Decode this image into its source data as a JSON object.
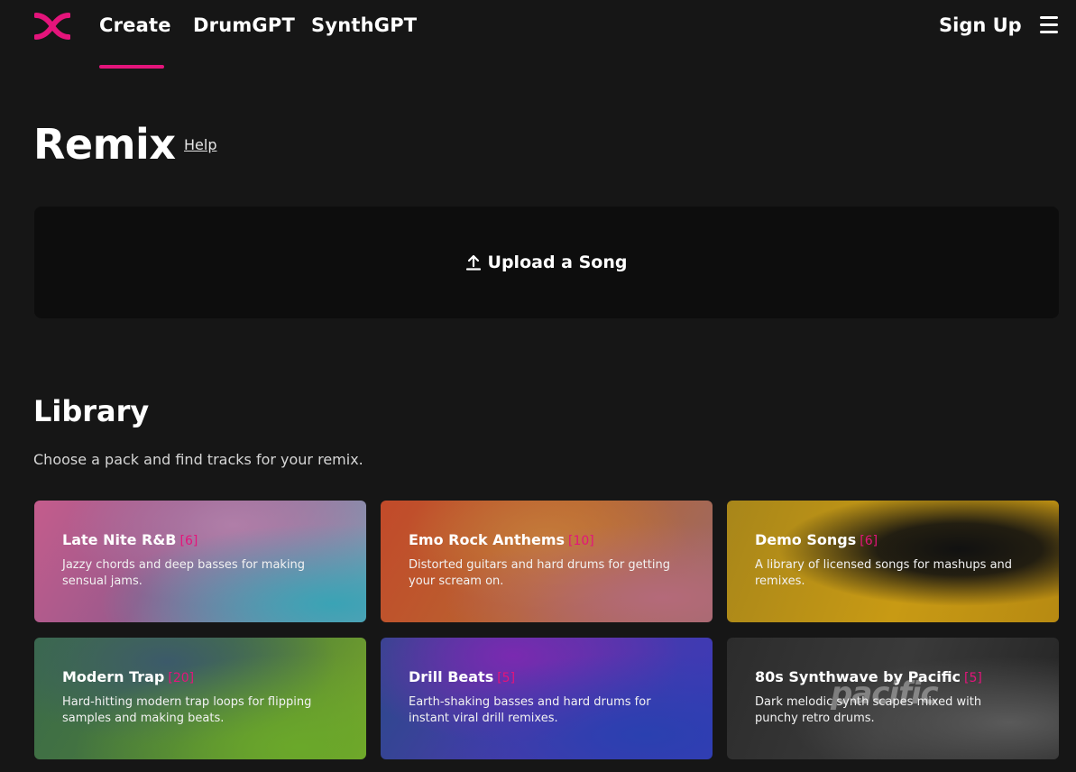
{
  "header": {
    "nav": [
      {
        "label": "Create"
      },
      {
        "label": "DrumGPT"
      },
      {
        "label": "SynthGPT"
      }
    ],
    "active_tab": "Create",
    "signup_label": "Sign Up",
    "accent_color": "#e4147b"
  },
  "remix": {
    "title": "Remix",
    "help_label": "Help",
    "upload_label": "Upload a Song"
  },
  "library": {
    "title": "Library",
    "subtitle": "Choose a pack and find tracks for your remix.",
    "packs": [
      {
        "title": "Late Nite R&B",
        "count": "[6]",
        "description": "Jazzy chords and deep basses for making sensual jams."
      },
      {
        "title": "Emo Rock Anthems",
        "count": "[10]",
        "description": "Distorted guitars and hard drums for getting your scream on."
      },
      {
        "title": "Demo Songs",
        "count": "[6]",
        "description": "A library of licensed songs for mashups and remixes."
      },
      {
        "title": "Modern Trap",
        "count": "[20]",
        "description": "Hard-hitting modern trap loops for flipping samples and making beats."
      },
      {
        "title": "Drill Beats",
        "count": "[5]",
        "description": "Earth-shaking basses and hard drums for instant viral drill remixes."
      },
      {
        "title": "80s Synthwave by Pacific",
        "count": "[5]",
        "description": "Dark melodic synth scapes mixed with punchy retro drums.",
        "image_text": "pacific"
      }
    ]
  }
}
